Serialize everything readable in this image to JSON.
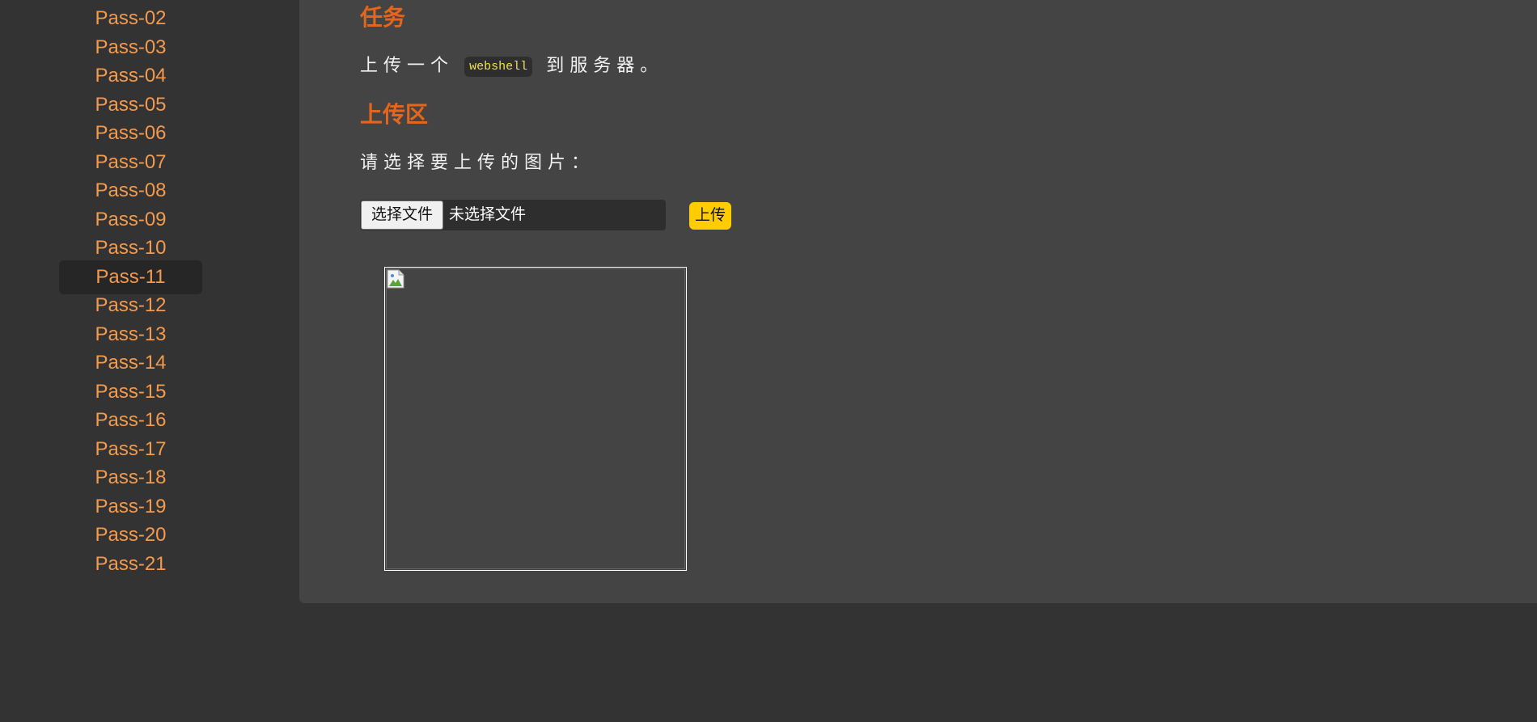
{
  "sidebar": {
    "items": [
      {
        "label": "Pass-02",
        "active": false
      },
      {
        "label": "Pass-03",
        "active": false
      },
      {
        "label": "Pass-04",
        "active": false
      },
      {
        "label": "Pass-05",
        "active": false
      },
      {
        "label": "Pass-06",
        "active": false
      },
      {
        "label": "Pass-07",
        "active": false
      },
      {
        "label": "Pass-08",
        "active": false
      },
      {
        "label": "Pass-09",
        "active": false
      },
      {
        "label": "Pass-10",
        "active": false
      },
      {
        "label": "Pass-11",
        "active": true
      },
      {
        "label": "Pass-12",
        "active": false
      },
      {
        "label": "Pass-13",
        "active": false
      },
      {
        "label": "Pass-14",
        "active": false
      },
      {
        "label": "Pass-15",
        "active": false
      },
      {
        "label": "Pass-16",
        "active": false
      },
      {
        "label": "Pass-17",
        "active": false
      },
      {
        "label": "Pass-18",
        "active": false
      },
      {
        "label": "Pass-19",
        "active": false
      },
      {
        "label": "Pass-20",
        "active": false
      },
      {
        "label": "Pass-21",
        "active": false
      }
    ]
  },
  "task": {
    "heading": "任务",
    "text_before": "上传一个",
    "code": "webshell",
    "text_after": "到服务器。"
  },
  "upload": {
    "heading": "上传区",
    "prompt": "请选择要上传的图片：",
    "file_button_label": "选择文件",
    "file_status": "未选择文件",
    "submit_label": "上传"
  },
  "preview": {
    "icon": "broken-image-icon"
  },
  "colors": {
    "accent": "#e4661c",
    "nav_link": "#f39a4d",
    "button": "#ffcc00",
    "code_text": "#f0e14a"
  }
}
